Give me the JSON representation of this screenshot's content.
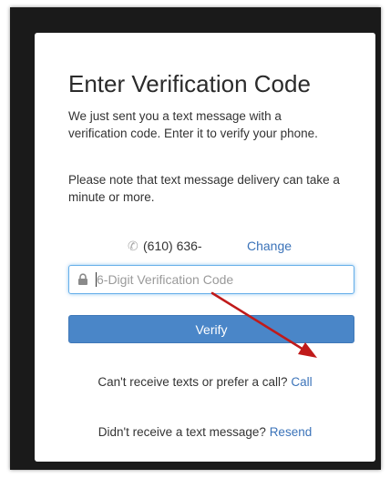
{
  "dialog": {
    "title": "Enter Verification Code",
    "intro": "We just sent you a text message with a verification code. Enter it to verify your phone.",
    "note": "Please note that text message delivery can take a minute or more."
  },
  "phone": {
    "icon": "phone-icon",
    "number": "(610) 636-",
    "change_label": "Change"
  },
  "code_input": {
    "icon": "lock-icon",
    "placeholder": "6-Digit Verification Code",
    "value": ""
  },
  "verify_button": {
    "label": "Verify"
  },
  "call_prompt": {
    "text": "Can't receive texts or prefer a call?",
    "link_label": "Call"
  },
  "resend_prompt": {
    "text": "Didn't receive a text message?",
    "link_label": "Resend"
  },
  "annotation": {
    "icon": "red-arrow-annotation",
    "color": "#c01a1a"
  },
  "colors": {
    "link": "#3b73b9",
    "button": "#4a86c8",
    "focus_border": "#66afe9"
  }
}
